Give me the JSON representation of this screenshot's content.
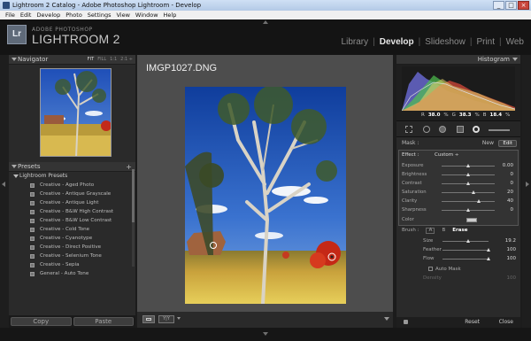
{
  "window": {
    "title": "Lightroom 2 Catalog - Adobe Photoshop Lightroom - Develop",
    "controls": [
      "_",
      "□",
      "×"
    ]
  },
  "menubar": [
    "File",
    "Edit",
    "Develop",
    "Photo",
    "Settings",
    "View",
    "Window",
    "Help"
  ],
  "brand": {
    "logo": "Lr",
    "line1": "ADOBE PHOTOSHOP",
    "line2": "LIGHTROOM 2"
  },
  "modules": [
    "Library",
    "Develop",
    "Slideshow",
    "Print",
    "Web"
  ],
  "active_module": "Develop",
  "navigator": {
    "title": "Navigator",
    "options": [
      "FIT",
      "FILL",
      "1:1",
      "2:1 ÷"
    ]
  },
  "presets": {
    "title": "Presets",
    "add": "+",
    "group": "Lightroom Presets",
    "items": [
      "Creative - Aged Photo",
      "Creative - Antique Grayscale",
      "Creative - Antique Light",
      "Creative - B&W High Contrast",
      "Creative - B&W Low Contrast",
      "Creative - Cold Tone",
      "Creative - Cyanotype",
      "Creative - Direct Positive",
      "Creative - Selenium Tone",
      "Creative - Sepia",
      "General - Auto Tone"
    ]
  },
  "left_buttons": {
    "copy": "Copy",
    "paste": "Paste"
  },
  "photo": {
    "filename": "IMGP1027.DNG"
  },
  "histogram": {
    "title": "Histogram",
    "r_label": "R",
    "r_value": "38.0",
    "g_label": "G",
    "g_value": "38.3",
    "b_label": "B",
    "b_value": "18.4",
    "unit": "%"
  },
  "mask": {
    "label": "Mask :",
    "new": "New",
    "edit": "Edit"
  },
  "effect": {
    "label": "Effect :",
    "value": "Custom ÷",
    "sliders": [
      {
        "label": "Exposure",
        "value": "0.00",
        "pos": 0.5
      },
      {
        "label": "Brightness",
        "value": "0",
        "pos": 0.5
      },
      {
        "label": "Contrast",
        "value": "0",
        "pos": 0.5
      },
      {
        "label": "Saturation",
        "value": "20",
        "pos": 0.6
      },
      {
        "label": "Clarity",
        "value": "40",
        "pos": 0.7
      },
      {
        "label": "Sharpness",
        "value": "0",
        "pos": 0.5
      }
    ],
    "color_label": "Color"
  },
  "brush": {
    "label": "Brush :",
    "a": "A",
    "b": "B",
    "erase": "Erase",
    "rows": [
      {
        "label": "Size",
        "value": "19.2",
        "pos": 0.55
      },
      {
        "label": "Feather",
        "value": "100",
        "pos": 1.0
      },
      {
        "label": "Flow",
        "value": "100",
        "pos": 1.0
      }
    ],
    "auto_mask": "Auto Mask",
    "density_label": "Density",
    "density_value": "100"
  },
  "footer": {
    "reset": "Reset",
    "close": "Close"
  }
}
